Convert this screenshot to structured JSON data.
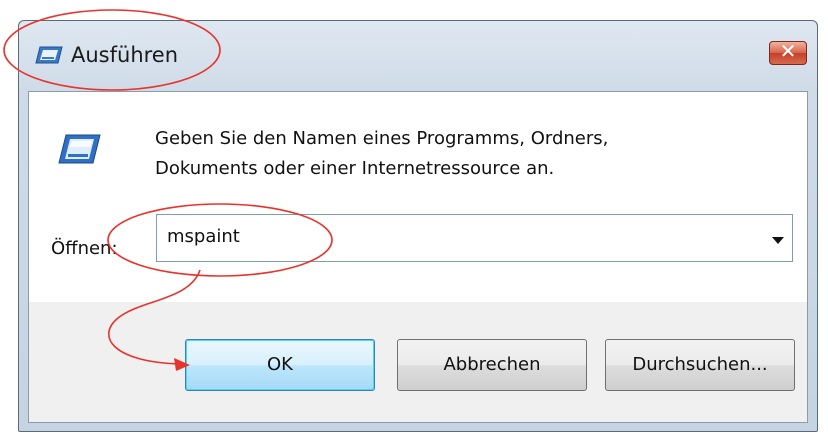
{
  "window": {
    "title": "Ausführen",
    "close_label": "✕",
    "description_line1": "Geben Sie den Namen eines Programms, Ordners,",
    "description_line2": "Dokuments oder einer Internetressource an.",
    "open_label": "Öffnen:",
    "open_value": "mspaint"
  },
  "buttons": {
    "ok": "OK",
    "cancel": "Abbrechen",
    "browse": "Durchsuchen..."
  },
  "icons": {
    "title": "run-icon",
    "main": "run-icon",
    "close": "close-icon",
    "dropdown": "chevron-down-icon"
  },
  "colors": {
    "annotation": "#e8332a",
    "ok_button": "#bee6fd",
    "close_button": "#d9624a"
  }
}
